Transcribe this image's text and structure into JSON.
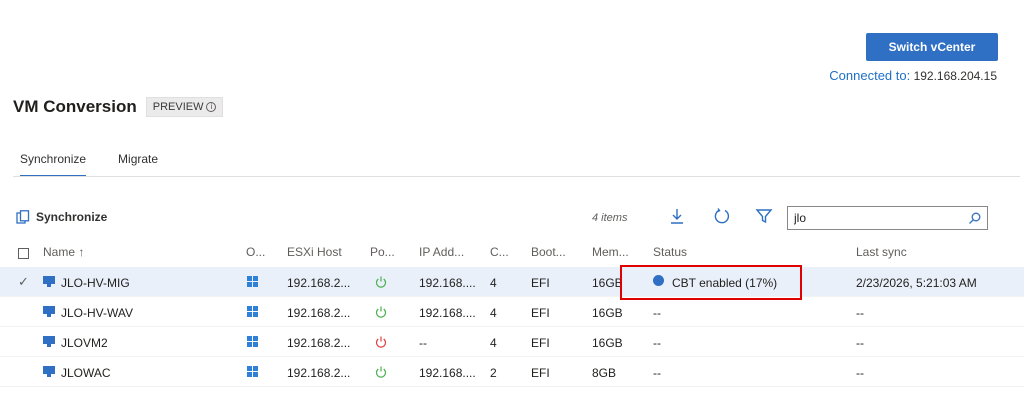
{
  "header": {
    "switch_button": "Switch vCenter",
    "connected_label": "Connected to:",
    "connected_value": "192.168.204.15"
  },
  "page": {
    "title": "VM Conversion",
    "badge": "PREVIEW",
    "info_glyph": "i"
  },
  "tabs": [
    {
      "label": "Synchronize",
      "active": true
    },
    {
      "label": "Migrate",
      "active": false
    }
  ],
  "toolbar": {
    "sync_label": "Synchronize",
    "items_count": "4 items",
    "search_value": "jlo"
  },
  "columns": {
    "name": "Name",
    "os": "O...",
    "esxi": "ESXi Host",
    "power": "Po...",
    "ip": "IP Add...",
    "cpu": "C...",
    "boot": "Boot...",
    "mem": "Mem...",
    "status": "Status",
    "last_sync": "Last sync"
  },
  "rows": [
    {
      "name": "JLO-HV-MIG",
      "esxi": "192.168.2...",
      "ip": "192.168....",
      "cpu": "4",
      "boot": "EFI",
      "mem": "16GB",
      "status": "CBT enabled (17%)",
      "last_sync": "2/23/2026, 5:21:03 AM",
      "power": "on",
      "selected": true
    },
    {
      "name": "JLO-HV-WAV",
      "esxi": "192.168.2...",
      "ip": "192.168....",
      "cpu": "4",
      "boot": "EFI",
      "mem": "16GB",
      "status": "--",
      "last_sync": "--",
      "power": "on",
      "selected": false
    },
    {
      "name": "JLOVM2",
      "esxi": "192.168.2...",
      "ip": "--",
      "cpu": "4",
      "boot": "EFI",
      "mem": "16GB",
      "status": "--",
      "last_sync": "--",
      "power": "off",
      "selected": false
    },
    {
      "name": "JLOWAC",
      "esxi": "192.168.2...",
      "ip": "192.168....",
      "cpu": "2",
      "boot": "EFI",
      "mem": "8GB",
      "status": "--",
      "last_sync": "--",
      "power": "on",
      "selected": false
    }
  ],
  "colors": {
    "accent": "#2f6fc4",
    "power_on": "#4caf50",
    "power_off": "#e04040",
    "highlight": "#e00000"
  }
}
